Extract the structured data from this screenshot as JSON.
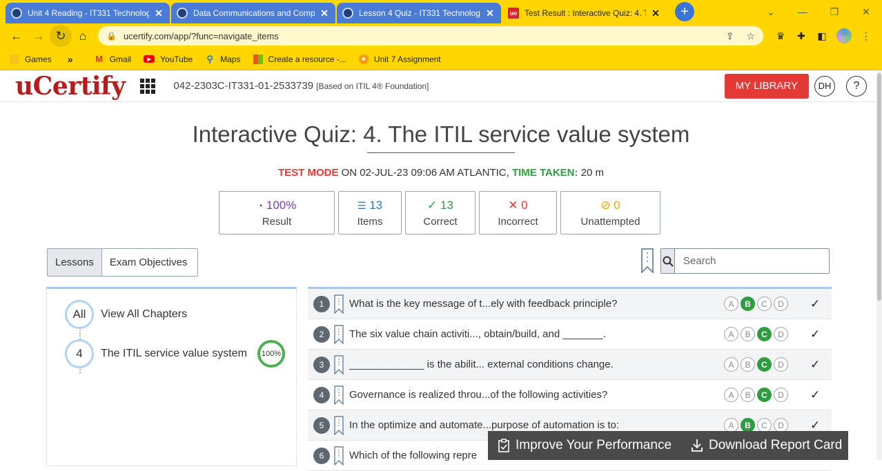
{
  "browser": {
    "tabs": [
      {
        "label": "Unit 4 Reading - IT331 Technolog",
        "active": false
      },
      {
        "label": "Data Communications and Comp",
        "active": false
      },
      {
        "label": "Lesson 4 Quiz - IT331 Technolog",
        "active": false
      },
      {
        "label": "Test Result : Interactive Quiz: 4. Th",
        "active": true
      }
    ],
    "favicon_text": "ue",
    "url": "ucertify.com/app/?func=navigate_items",
    "bookmarks": [
      "Games",
      "Gmail",
      "YouTube",
      "Maps",
      "Create a resource -...",
      "Unit 7 Assignment"
    ],
    "theme_color": "#ffd600"
  },
  "header": {
    "logo": "uCertify",
    "course_code": "042-2303C-IT331-01-2533739",
    "course_note": "[Based on ITIL 4® Foundation]",
    "my_library": "MY LIBRARY",
    "user_initials": "DH",
    "help": "?"
  },
  "page": {
    "title": "Interactive Quiz: 4. The ITIL service value system",
    "test_mode_label": "TEST MODE",
    "on_date": "ON 02-JUL-23 09:06 AM ATLANTIC,",
    "time_taken_label": "TIME TAKEN:",
    "time_taken_value": "20 m"
  },
  "stats": {
    "result_value": "100%",
    "result_label": "Result",
    "items_value": "13",
    "items_label": "Items",
    "correct_value": "13",
    "correct_label": "Correct",
    "incorrect_value": "0",
    "incorrect_label": "Incorrect",
    "unattempted_value": "0",
    "unattempted_label": "Unattempted"
  },
  "filters": {
    "tab_lessons": "Lessons",
    "tab_objectives": "Exam Objectives",
    "search_placeholder": "Search"
  },
  "chapters": [
    {
      "badge": "All",
      "label": "View All Chapters"
    },
    {
      "badge": "4",
      "label": "The ITIL service value system",
      "progress": "100%"
    }
  ],
  "questions": [
    {
      "num": "1",
      "text": "What is the key message of t...ely with feedback principle?",
      "answer": "B"
    },
    {
      "num": "2",
      "text": "The six value chain activiti..., obtain/build, and _______.",
      "answer": "C"
    },
    {
      "num": "3",
      "text": "_____________ is the abilit... external conditions change.",
      "answer": "C"
    },
    {
      "num": "4",
      "text": "Governance is realized throu...of the following activities?",
      "answer": "C"
    },
    {
      "num": "5",
      "text": "In the optimize and automate...purpose of automation is to:",
      "answer": "B"
    },
    {
      "num": "6",
      "text": "Which of the following repre",
      "answer": ""
    }
  ],
  "options": [
    "A",
    "B",
    "C",
    "D"
  ],
  "floatbar": {
    "improve": "Improve Your Performance",
    "download": "Download Report Card"
  }
}
